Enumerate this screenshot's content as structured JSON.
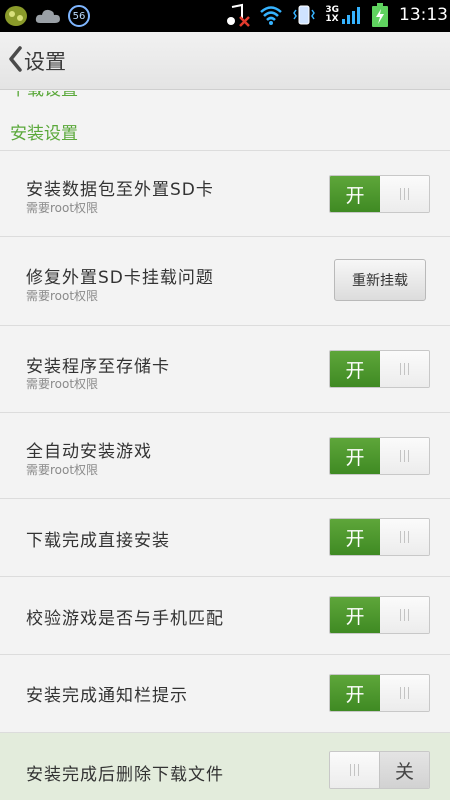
{
  "status_bar": {
    "badge_text": "56",
    "network_top": "3G",
    "network_bottom": "1X",
    "time": "13:13",
    "icons": [
      "app-icon",
      "cloud-icon",
      "badge-56-icon",
      "music-muted-icon",
      "wifi-icon",
      "vibrate-icon",
      "signal-icon",
      "battery-charging-icon"
    ]
  },
  "header": {
    "back_icon": "chevron-left-icon",
    "title": "设置"
  },
  "sections": {
    "previous_header_partial": "下载设置",
    "install_header": "安装设置"
  },
  "rows": [
    {
      "title": "安装数据包至外置SD卡",
      "subtitle": "需要root权限",
      "control": "toggle",
      "state": "on",
      "on_label": "开"
    },
    {
      "title": "修复外置SD卡挂载问题",
      "subtitle": "需要root权限",
      "control": "button",
      "button_label": "重新挂载"
    },
    {
      "title": "安装程序至存储卡",
      "subtitle": "需要root权限",
      "control": "toggle",
      "state": "on",
      "on_label": "开"
    },
    {
      "title": "全自动安装游戏",
      "subtitle": "需要root权限",
      "control": "toggle",
      "state": "on",
      "on_label": "开"
    },
    {
      "title": "下载完成直接安装",
      "control": "toggle",
      "state": "on",
      "on_label": "开"
    },
    {
      "title": "校验游戏是否与手机匹配",
      "control": "toggle",
      "state": "on",
      "on_label": "开"
    },
    {
      "title": "安装完成通知栏提示",
      "control": "toggle",
      "state": "on",
      "on_label": "开"
    },
    {
      "title": "安装完成后删除下载文件",
      "control": "toggle",
      "state": "off",
      "off_label": "关"
    }
  ],
  "colors": {
    "accent_green": "#5aa83a",
    "toggle_on": "#4a9a2c",
    "highlight_row": "#e3ecdc"
  }
}
